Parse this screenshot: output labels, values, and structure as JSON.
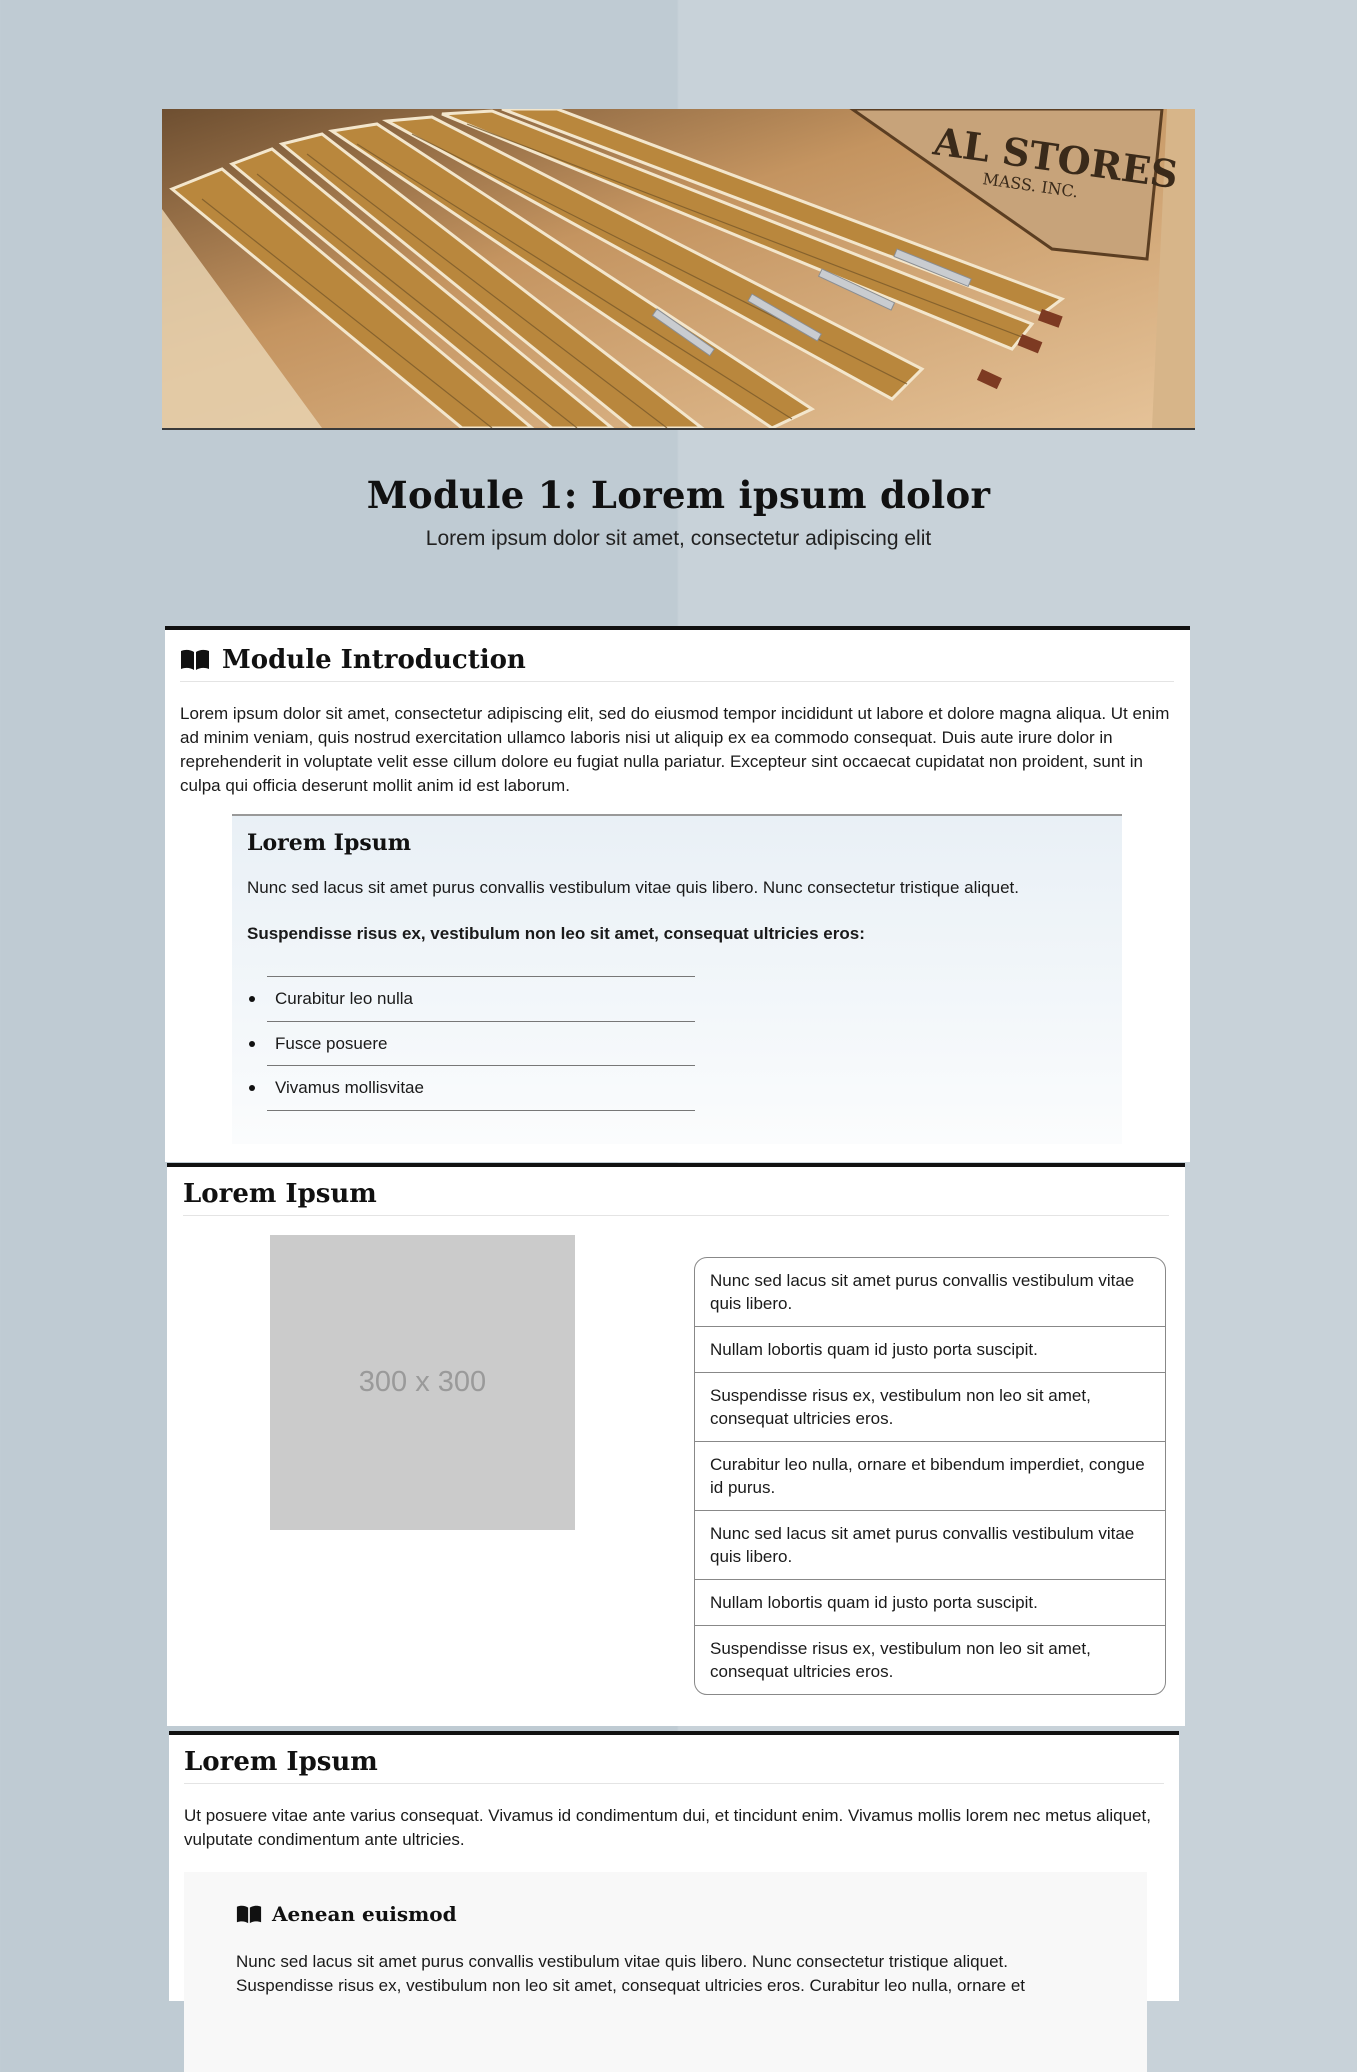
{
  "hero": {
    "sign_text": "AL STORES",
    "sign_sub": "MASS. INC."
  },
  "page": {
    "title": "Module 1: Lorem ipsum dolor",
    "subtitle": "Lorem ipsum dolor sit amet, consectetur adipiscing elit"
  },
  "intro": {
    "heading": "Module Introduction",
    "body": "Lorem ipsum dolor sit amet, consectetur adipiscing elit, sed do eiusmod tempor incididunt ut labore et dolore magna aliqua. Ut enim ad minim veniam, quis nostrud exercitation ullamco laboris nisi ut aliquip ex ea commodo consequat. Duis aute irure dolor in reprehenderit in voluptate velit esse cillum dolore eu fugiat nulla pariatur. Excepteur sint occaecat cupidatat non proident, sunt in culpa qui officia deserunt mollit anim id est laborum.",
    "callout": {
      "heading": "Lorem Ipsum",
      "text": "Nunc sed lacus sit amet purus convallis vestibulum vitae quis libero. Nunc consectetur tristique aliquet.",
      "strong_text": "Suspendisse risus ex, vestibulum non leo sit amet, consequat ultricies eros:",
      "bullets": [
        "Curabitur leo nulla",
        "Fusce posuere",
        "Vivamus mollisvitae"
      ]
    }
  },
  "section2": {
    "heading": "Lorem Ipsum",
    "placeholder_label": "300 x 300",
    "items": [
      "Nunc sed lacus sit amet purus convallis vestibulum vitae quis libero.",
      "Nullam lobortis quam id justo porta suscipit.",
      "Suspendisse risus ex, vestibulum non leo sit amet, consequat ultricies eros.",
      "Curabitur leo nulla, ornare et bibendum imperdiet, congue id purus.",
      "Nunc sed lacus sit amet purus convallis vestibulum vitae quis libero.",
      "Nullam lobortis quam id justo porta suscipit.",
      "Suspendisse risus ex, vestibulum non leo sit amet, consequat ultricies eros."
    ]
  },
  "section3": {
    "heading": "Lorem Ipsum",
    "body": "Ut posuere vitae ante varius consequat. Vivamus id condimentum dui, et tincidunt enim. Vivamus mollis lorem nec metus aliquet, vulputate condimentum ante ultricies.",
    "panel": {
      "heading": "Aenean euismod",
      "body": "Nunc sed lacus sit amet purus convallis vestibulum vitae quis libero. Nunc consectetur tristique aliquet. Suspendisse risus ex, vestibulum non leo sit amet, consequat ultricies eros. Curabitur leo nulla, ornare et"
    }
  }
}
